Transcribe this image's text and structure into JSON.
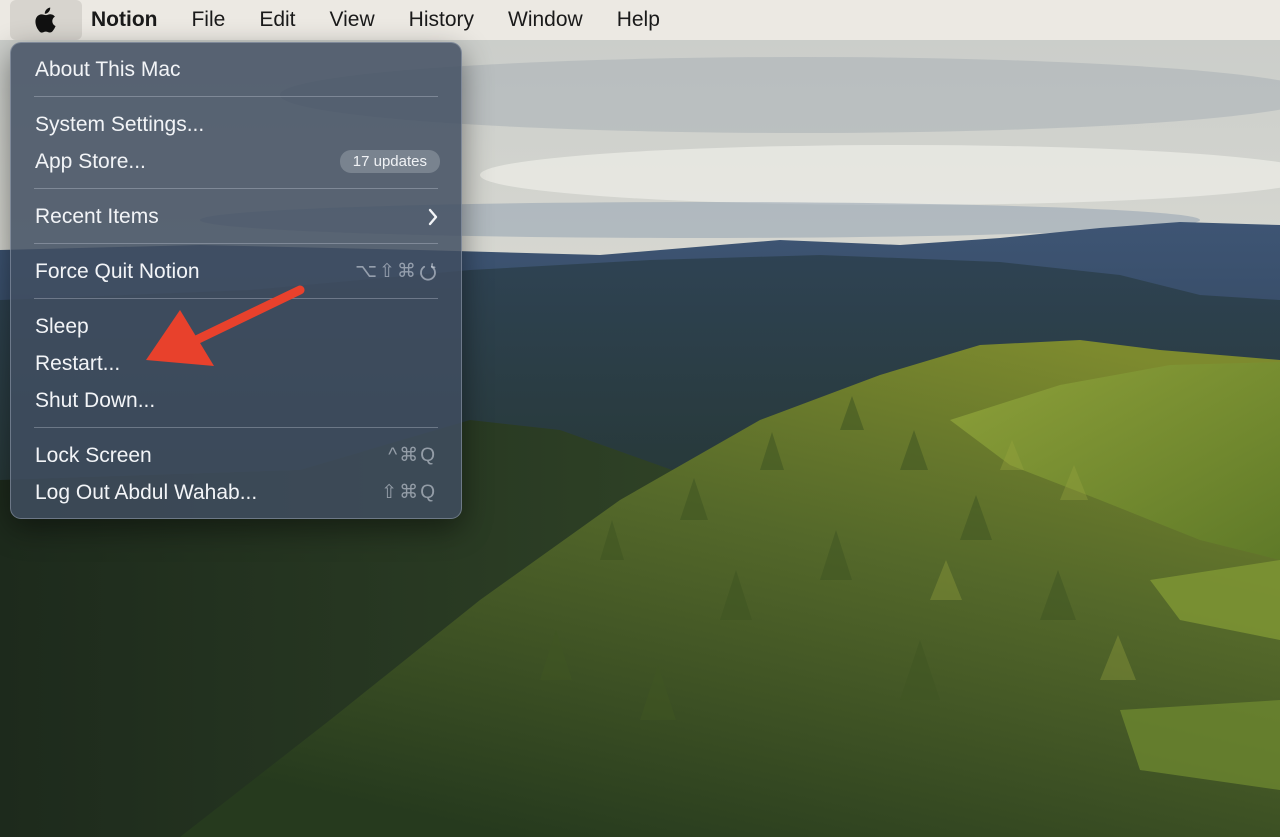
{
  "menubar": {
    "app_name": "Notion",
    "items": [
      "File",
      "Edit",
      "View",
      "History",
      "Window",
      "Help"
    ]
  },
  "apple_menu": {
    "about": "About This Mac",
    "system_settings": "System Settings...",
    "app_store": "App Store...",
    "app_store_badge": "17 updates",
    "recent_items": "Recent Items",
    "force_quit": "Force Quit Notion",
    "force_quit_shortcut": "⌥⇧⌘",
    "sleep": "Sleep",
    "restart": "Restart...",
    "shut_down": "Shut Down...",
    "lock_screen": "Lock Screen",
    "lock_screen_shortcut": "^⌘Q",
    "log_out": "Log Out Abdul Wahab...",
    "log_out_shortcut": "⇧⌘Q"
  },
  "colors": {
    "menubar_bg": "#ece9e3",
    "menu_bg": "#404e60",
    "annotation_arrow": "#e8412c"
  },
  "icons": {
    "apple": "apple-logo-icon",
    "submenu": "chevron-right-icon",
    "power": "power-icon",
    "annotation": "red-arrow-icon"
  }
}
